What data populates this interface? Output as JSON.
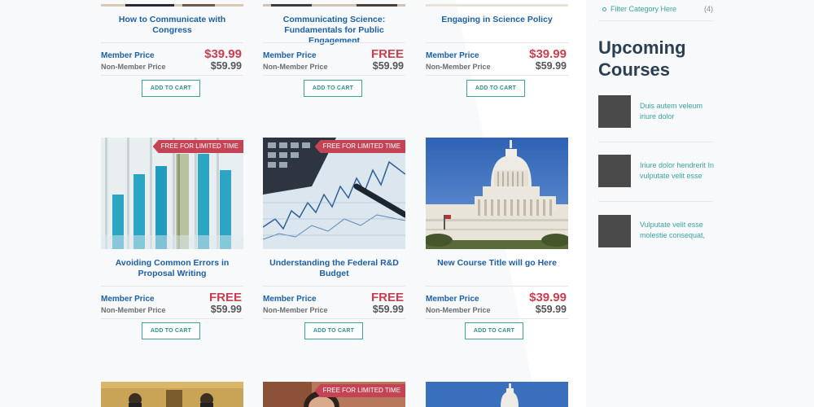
{
  "products_row1": [
    {
      "title": "How to Communicate with Congress",
      "member_label": "Member Price",
      "member_price": "$39.99",
      "non_label": "Non-Member Price",
      "non_price": "$59.99",
      "cart": "ADD TO CART"
    },
    {
      "title": "Communicating Science: Fundamentals for Public Engagement",
      "member_label": "Member Price",
      "member_price": "FREE",
      "non_label": "Non-Member Price",
      "non_price": "$59.99",
      "cart": "ADD TO CART"
    },
    {
      "title": "Engaging in Science Policy",
      "member_label": "Member Price",
      "member_price": "$39.99",
      "non_label": "Non-Member Price",
      "non_price": "$59.99",
      "cart": "ADD TO CART"
    }
  ],
  "products_row2": [
    {
      "title": "Avoiding Common Errors in Proposal Writing",
      "ribbon": "FREE FOR LIMITED TIME",
      "member_label": "Member Price",
      "member_price": "FREE",
      "non_label": "Non-Member Price",
      "non_price": "$59.99",
      "cart": "ADD TO CART"
    },
    {
      "title": "Understanding the Federal R&D Budget",
      "ribbon": "FREE FOR LIMITED TIME",
      "member_label": "Member Price",
      "member_price": "FREE",
      "non_label": "Non-Member Price",
      "non_price": "$59.99",
      "cart": "ADD TO CART"
    },
    {
      "title": "New Course Title will go Here",
      "member_label": "Member Price",
      "member_price": "$39.99",
      "non_label": "Non-Member Price",
      "non_price": "$59.99",
      "cart": "ADD TO CART"
    }
  ],
  "products_row3": [
    {
      "ribbon": ""
    },
    {
      "ribbon": "FREE FOR LIMITED TIME"
    },
    {
      "ribbon": ""
    }
  ],
  "sidebar": {
    "filter": {
      "label": "Filter Category Here",
      "count": "(4)"
    },
    "heading": "Upcoming Courses",
    "courses": [
      {
        "text": "Duis autem veleum iriure dolor"
      },
      {
        "text": "Iriure dolor hendrerit  In vulputate velit esse"
      },
      {
        "text": "Vulputate velit esse molestie consequat,"
      }
    ]
  },
  "colors": {
    "accent_teal": "#3aa3a0",
    "link_blue": "#1d5fa3",
    "price_red": "#c8404e",
    "ribbon_red": "#c44455"
  }
}
